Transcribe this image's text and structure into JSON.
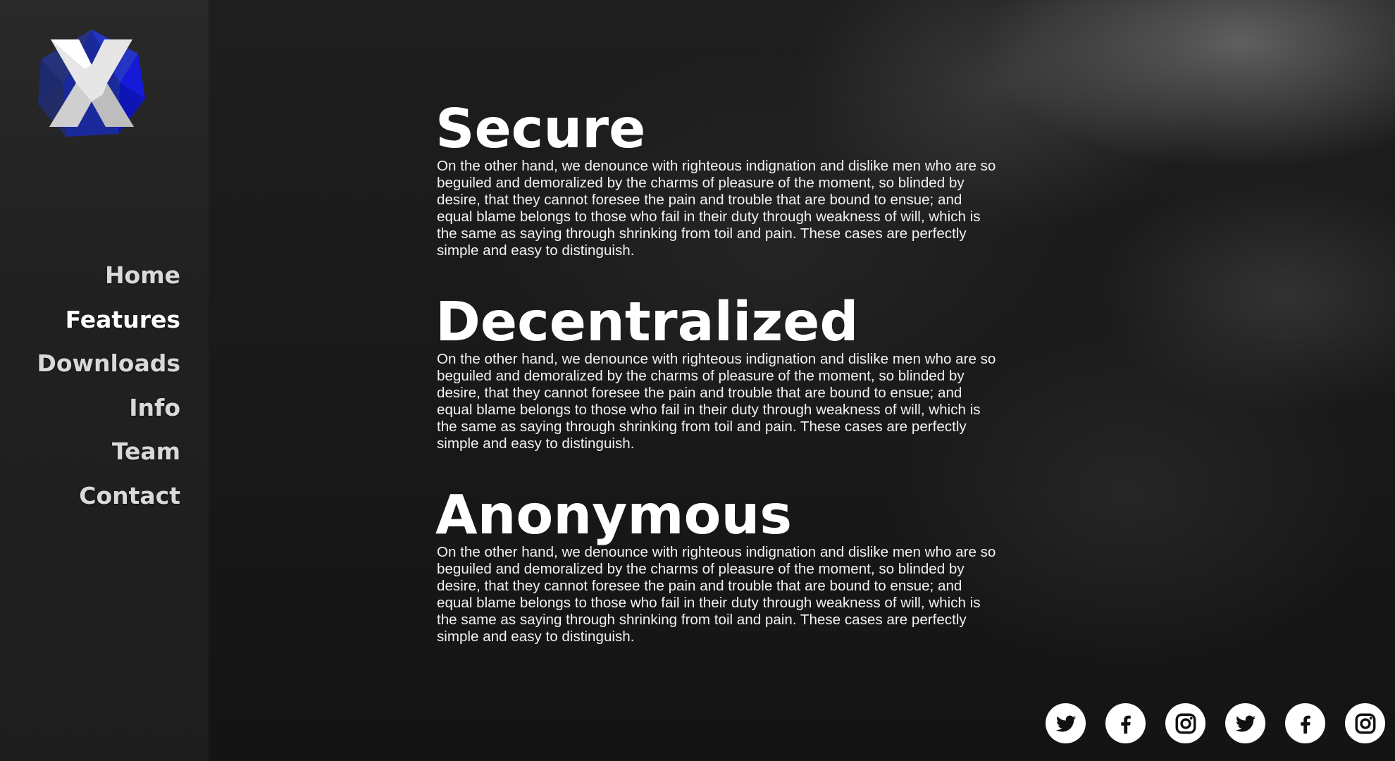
{
  "brand": {
    "logo_icon": "x-hexagon-logo-icon",
    "accent": "#1a22c8"
  },
  "nav": {
    "items": [
      {
        "label": "Home",
        "active": false
      },
      {
        "label": "Features",
        "active": true
      },
      {
        "label": "Downloads",
        "active": false
      },
      {
        "label": "Info",
        "active": false
      },
      {
        "label": "Team",
        "active": false
      },
      {
        "label": "Contact",
        "active": false
      }
    ]
  },
  "sections": [
    {
      "title": "Secure",
      "text": "On the other hand, we denounce with righteous indignation and dislike men who are so beguiled and demoralized by the charms of pleasure of the moment, so blinded by desire, that they cannot foresee the pain and trouble that are bound to ensue; and equal blame belongs to those who fail in their duty through weakness of will, which is the same as saying through shrinking from toil and pain. These cases are perfectly simple and easy to distinguish."
    },
    {
      "title": "Decentralized",
      "text": "On the other hand, we denounce with righteous indignation and dislike men who are so beguiled and demoralized by the charms of pleasure of the moment, so blinded by desire, that they cannot foresee the pain and trouble that are bound to ensue; and equal blame belongs to those who fail in their duty through weakness of will, which is the same as saying through shrinking from toil and pain. These cases are perfectly simple and easy to distinguish."
    },
    {
      "title": "Anonymous",
      "text": "On the other hand, we denounce with righteous indignation and dislike men who are so beguiled and demoralized by the charms of pleasure of the moment, so blinded by desire, that they cannot foresee the pain and trouble that are bound to ensue; and equal blame belongs to those who fail in their duty through weakness of will, which is the same as saying through shrinking from toil and pain. These cases are perfectly simple and easy to distinguish."
    }
  ],
  "socials": [
    {
      "icon": "twitter-icon"
    },
    {
      "icon": "facebook-icon"
    },
    {
      "icon": "instagram-icon"
    },
    {
      "icon": "twitter-icon"
    },
    {
      "icon": "facebook-icon"
    },
    {
      "icon": "instagram-icon"
    }
  ]
}
